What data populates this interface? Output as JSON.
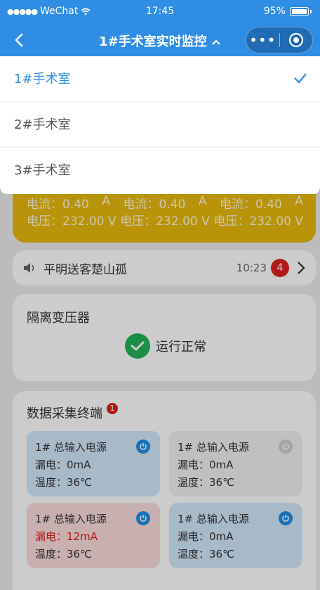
{
  "statusbar": {
    "carrier": "WeChat",
    "time": "17:45",
    "battery": "95%"
  },
  "navbar": {
    "title": "1#手术室实时监控"
  },
  "dropdown": {
    "items": [
      {
        "label": "1#手术室",
        "selected": true
      },
      {
        "label": "2#手术室",
        "selected": false
      },
      {
        "label": "3#手术室",
        "selected": false
      }
    ]
  },
  "power": {
    "currents": [
      "电流：0.40",
      "A",
      "电流：0.40",
      "A",
      "电流：0.40",
      "A"
    ],
    "voltages": [
      "电压：232.00 V",
      "电压：232.00 V",
      "电压：232.00 V"
    ]
  },
  "notice": {
    "text": "平明送客楚山孤",
    "time": "10:23",
    "count": "4"
  },
  "isolation": {
    "title": "隔离变压器",
    "status": "运行正常"
  },
  "terminal": {
    "title": "数据采集终端",
    "badge": "1",
    "tiles": [
      {
        "name": "1# 总输入电源",
        "leak": "漏电：0mA",
        "temp": "温度：36℃",
        "state": "on",
        "style": "blue"
      },
      {
        "name": "1# 总输入电源",
        "leak": "漏电：0mA",
        "temp": "温度：36℃",
        "state": "off",
        "style": "grey"
      },
      {
        "name": "1# 总输入电源",
        "leak": "漏电：12mA",
        "temp": "温度：36℃",
        "state": "on",
        "style": "red"
      },
      {
        "name": "1# 总输入电源",
        "leak": "漏电：0mA",
        "temp": "温度：36℃",
        "state": "on",
        "style": "blue"
      }
    ]
  },
  "colors": {
    "primary": "#2f8de4",
    "warning": "#e8b90e",
    "alarm": "#e02020",
    "ok": "#22b25a"
  }
}
